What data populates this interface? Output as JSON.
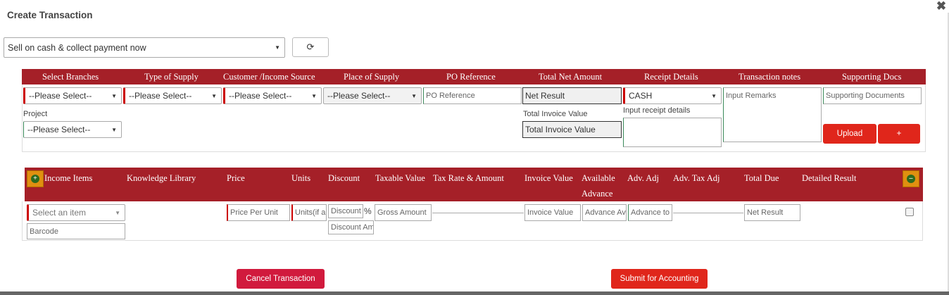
{
  "dialog": {
    "title": "Create Transaction",
    "close_symbol": "✖"
  },
  "transaction_type": {
    "selected": "Sell on cash & collect payment now"
  },
  "refresh": {
    "symbol": "⟳"
  },
  "header_row": {
    "cols": [
      "Select Branches",
      "Type of Supply",
      "Customer /Income Source",
      "Place of Supply",
      "PO Reference",
      "Total Net Amount",
      "Receipt Details",
      "Transaction notes",
      "Supporting Docs"
    ]
  },
  "form": {
    "branch": "--Please Select--",
    "supply_type": "--Please Select--",
    "customer": "--Please Select--",
    "place": "--Please Select--",
    "po_placeholder": "PO Reference",
    "net_result": "Net Result",
    "receipt_mode": "CASH",
    "remarks_placeholder": "Input Remarks",
    "docs_placeholder": "Supporting Documents",
    "project_label": "Project",
    "project": "--Please Select--",
    "total_invoice_label": "Total Invoice Value",
    "total_invoice": "Total Invoice Value",
    "receipt_details_label": "Input receipt details",
    "upload_label": "Upload",
    "plus_label": "+"
  },
  "items_header": {
    "cols": [
      "Income Items",
      "Knowledge Library",
      "Price",
      "Units",
      "Discount",
      "Taxable Value",
      "Tax Rate & Amount",
      "Invoice Value",
      "Available",
      "Advance",
      "Adv. Adj",
      "Adv. Tax Adj",
      "Total Due",
      "Detailed Result"
    ],
    "add_symbol": "+",
    "remove_symbol": "–"
  },
  "item_row": {
    "item_select": "Select an item",
    "price": "Price Per Unit",
    "units": "Units(if any)",
    "discount": "Discount %",
    "percent": "%",
    "discount_amount": "Discount Amount",
    "gross": "Gross Amount",
    "invoice": "Invoice Value",
    "advance_available": "Advance Available",
    "advance_to": "Advance to adjust",
    "net_result": "Net Result",
    "barcode": "Barcode"
  },
  "footer": {
    "cancel": "Cancel Transaction",
    "submit": "Submit for Accounting"
  },
  "colors": {
    "header": "#a52028",
    "submit": "#e0261b",
    "cancel": "#d11a3d"
  }
}
